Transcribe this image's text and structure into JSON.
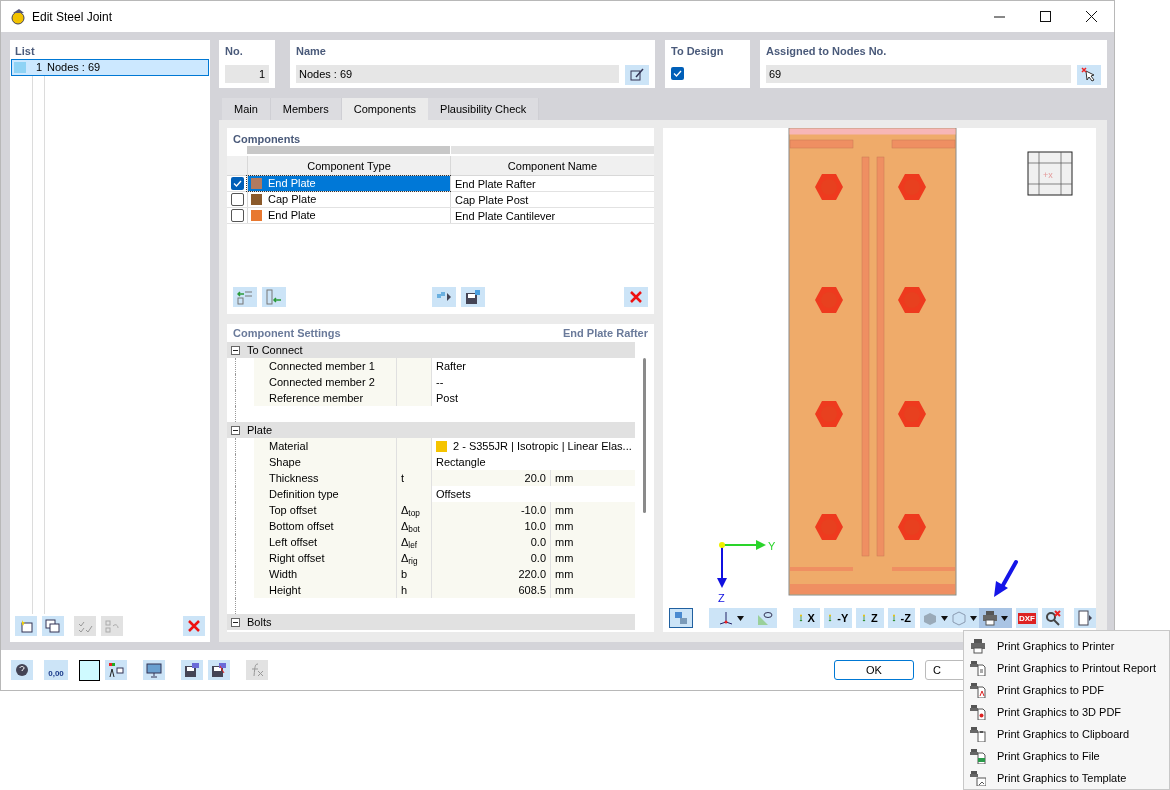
{
  "window": {
    "title": "Edit Steel Joint"
  },
  "list": {
    "header": "List",
    "items": [
      {
        "number": "1",
        "label": "Nodes : 69",
        "selected": true
      }
    ]
  },
  "header_fields": {
    "number": {
      "label": "No.",
      "value": "1"
    },
    "name": {
      "label": "Name",
      "value": "Nodes : 69"
    },
    "to_design": {
      "label": "To Design",
      "checked": true
    },
    "assigned": {
      "label": "Assigned to Nodes No.",
      "value": "69"
    }
  },
  "tabs": [
    {
      "label": "Main",
      "selected": false
    },
    {
      "label": "Members",
      "selected": false
    },
    {
      "label": "Components",
      "selected": true
    },
    {
      "label": "Plausibility Check",
      "selected": false
    }
  ],
  "components": {
    "title": "Components",
    "columns": [
      "Component Type",
      "Component Name"
    ],
    "rows": [
      {
        "checked": true,
        "selected": true,
        "color": "#b07a60",
        "type": "End Plate",
        "name": "End Plate Rafter"
      },
      {
        "checked": false,
        "selected": false,
        "color": "#8b5a2b",
        "type": "Cap Plate",
        "name": "Cap Plate Post"
      },
      {
        "checked": false,
        "selected": false,
        "color": "#e87830",
        "type": "End Plate",
        "name": "End Plate Cantilever"
      }
    ]
  },
  "settings": {
    "title": "Component Settings",
    "subtitle": "End Plate Rafter",
    "groups": [
      {
        "label": "To Connect",
        "expanded": true,
        "rows": [
          {
            "kind": "text",
            "label": "Connected member 1",
            "value": "Rafter"
          },
          {
            "kind": "text",
            "label": "Connected member 2",
            "value": "--"
          },
          {
            "kind": "text",
            "label": "Reference member",
            "value": "Post"
          }
        ]
      },
      {
        "label": "Plate",
        "expanded": true,
        "rows": [
          {
            "kind": "material",
            "label": "Material",
            "value": "2 - S355JR | Isotropic | Linear Elas...",
            "color": "#f5c400"
          },
          {
            "kind": "text",
            "label": "Shape",
            "value": "Rectangle"
          },
          {
            "kind": "number",
            "label": "Thickness",
            "symbol": "t",
            "value": "20.0",
            "unit": "mm"
          },
          {
            "kind": "text",
            "label": "Definition type",
            "value": "Offsets"
          },
          {
            "kind": "number",
            "label": "Top offset",
            "symbol": "Δ$_{top}$",
            "value": "-10.0",
            "unit": "mm"
          },
          {
            "kind": "number",
            "label": "Bottom offset",
            "symbol": "Δ$_{bot}$",
            "value": "10.0",
            "unit": "mm"
          },
          {
            "kind": "number",
            "label": "Left offset",
            "symbol": "Δ$_{lef}$",
            "value": "0.0",
            "unit": "mm"
          },
          {
            "kind": "number",
            "label": "Right offset",
            "symbol": "Δ$_{rig}$",
            "value": "0.0",
            "unit": "mm"
          },
          {
            "kind": "number",
            "label": "Width",
            "symbol": "b",
            "value": "220.0",
            "unit": "mm"
          },
          {
            "kind": "number",
            "label": "Height",
            "symbol": "h",
            "value": "608.5",
            "unit": "mm"
          }
        ]
      },
      {
        "label": "Bolts",
        "expanded": true
      }
    ]
  },
  "graphic": {
    "y_axis": "Y",
    "z_axis": "Z",
    "view_cube": "+x",
    "toolbar": [
      {
        "kind": "view-x",
        "label": "X"
      },
      {
        "kind": "view-y",
        "label": "-Y"
      },
      {
        "kind": "view-z",
        "label": "Z"
      },
      {
        "kind": "view-z",
        "label": "-Z"
      },
      {
        "kind": "dxf",
        "label": "DXF"
      }
    ],
    "print_pressed": true
  },
  "print_menu": [
    {
      "kind": "printer",
      "label": "Print Graphics to Printer"
    },
    {
      "kind": "report",
      "label": "Print Graphics to Printout Report"
    },
    {
      "kind": "pdf",
      "label": "Print Graphics to PDF"
    },
    {
      "kind": "pdf3d",
      "label": "Print Graphics to 3D PDF"
    },
    {
      "kind": "clipboard",
      "label": "Print Graphics to Clipboard"
    },
    {
      "kind": "file",
      "label": "Print Graphics to File"
    },
    {
      "kind": "template",
      "label": "Print Graphics to Template"
    }
  ],
  "units_icon": "0,00",
  "buttons": {
    "ok": "OK",
    "cancel": "C"
  }
}
